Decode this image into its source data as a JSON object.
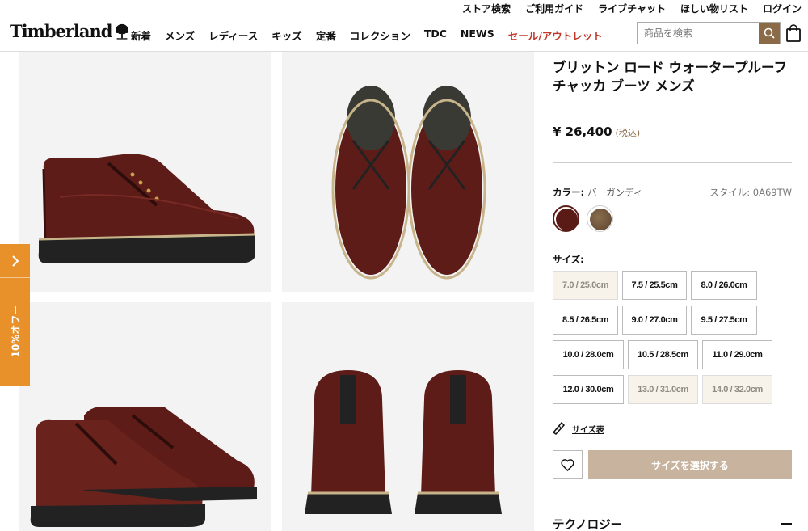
{
  "utility_nav": [
    "ストア検索",
    "ご利用ガイド",
    "ライブチャット",
    "ほしい物リスト",
    "ログイン"
  ],
  "brand": "Timberland",
  "main_nav": [
    "新着",
    "メンズ",
    "レディース",
    "キッズ",
    "定番",
    "コレクション",
    "TDC",
    "NEWS",
    "セール/アウトレット"
  ],
  "search": {
    "placeholder": "商品を検索"
  },
  "promo_tab": {
    "label": "10%オフー"
  },
  "product": {
    "title": "ブリットン ロード ウォータープルーフ チャッカ ブーツ メンズ",
    "price": "¥ 26,400",
    "tax_note": "(税込)",
    "color_label": "カラー:",
    "color_value": "バーガンディー",
    "style_label": "スタイル: 0A69TW",
    "swatches": [
      {
        "name": "burgundy",
        "color": "#5a1a16",
        "selected": true
      },
      {
        "name": "brown",
        "color": "#6b5138",
        "selected": false
      }
    ],
    "size_label": "サイズ:",
    "sizes": [
      {
        "label": "7.0 / 25.0cm",
        "available": false
      },
      {
        "label": "7.5 / 25.5cm",
        "available": true
      },
      {
        "label": "8.0 / 26.0cm",
        "available": true
      },
      {
        "label": "8.5 / 26.5cm",
        "available": true
      },
      {
        "label": "9.0 / 27.0cm",
        "available": true
      },
      {
        "label": "9.5 / 27.5cm",
        "available": true
      },
      {
        "label": "10.0 / 28.0cm",
        "available": true
      },
      {
        "label": "10.5 / 28.5cm",
        "available": true
      },
      {
        "label": "11.0 / 29.0cm",
        "available": true
      },
      {
        "label": "12.0 / 30.0cm",
        "available": true
      },
      {
        "label": "13.0 / 31.0cm",
        "available": false
      },
      {
        "label": "14.0 / 32.0cm",
        "available": false
      }
    ],
    "size_guide": "サイズ表",
    "select_button": "サイズを選択する",
    "technology_heading": "テクノロジー"
  },
  "colors": {
    "accent": "#8a6a47",
    "sale": "#c0392b",
    "promo": "#e8912a",
    "cta": "#c8b39e"
  }
}
